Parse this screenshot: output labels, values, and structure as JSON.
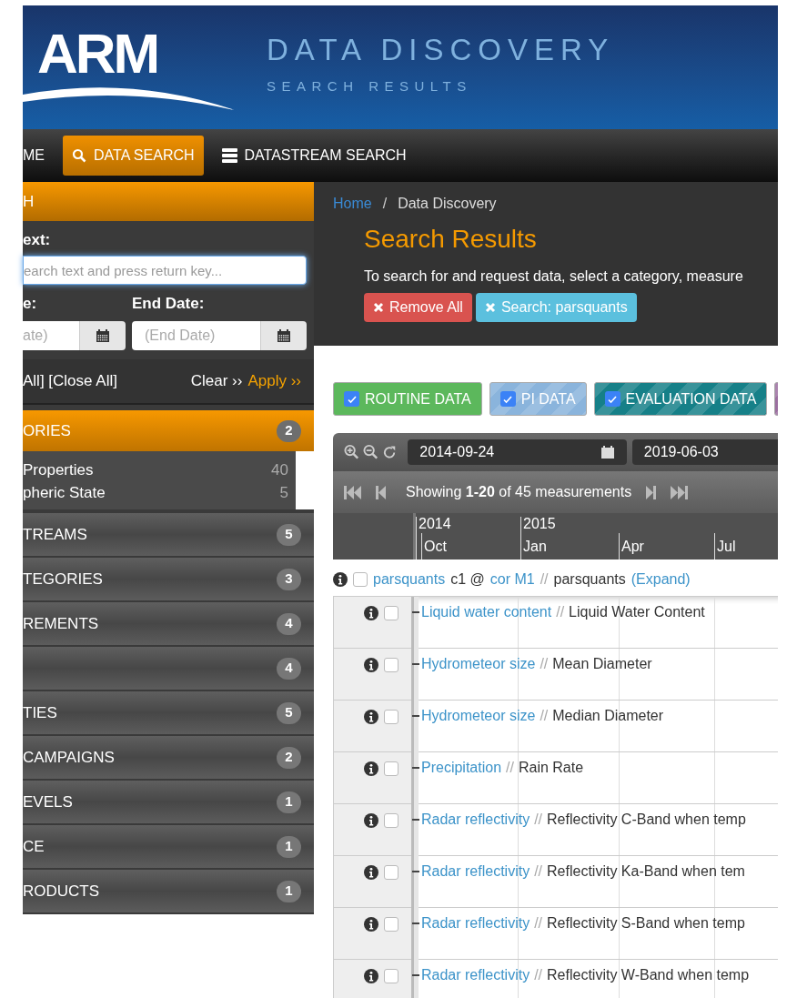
{
  "header": {
    "logo": "ARM",
    "title": "DATA DISCOVERY",
    "subtitle": "SEARCH RESULTS"
  },
  "nav": [
    {
      "label": "ME",
      "selected": false,
      "kind": "plain"
    },
    {
      "label": "DATA SEARCH",
      "selected": true,
      "kind": "search"
    },
    {
      "label": "DATASTREAM SEARCH",
      "selected": false,
      "kind": "server"
    }
  ],
  "sidebar": {
    "heading": "H",
    "text_label": "ext:",
    "search_placeholder": "earch text and press return key...",
    "start_label": "e:",
    "end_label": "End Date:",
    "start_placeholder": "ate)",
    "end_placeholder": "(End Date)",
    "toggle_links": "All] [Close All]",
    "clear": "Clear ››",
    "apply": "Apply ››",
    "facets": [
      {
        "label": "ORIES",
        "count": "2",
        "expanded": true,
        "children": [
          {
            "label": "Properties",
            "count": "40"
          },
          {
            "label": "pheric State",
            "count": "5"
          }
        ]
      },
      {
        "label": "TREAMS",
        "count": "5",
        "expanded": false
      },
      {
        "label": "TEGORIES",
        "count": "3",
        "expanded": false
      },
      {
        "label": "REMENTS",
        "count": "4",
        "expanded": false
      },
      {
        "count": "4",
        "expanded": false
      },
      {
        "label": "TIES",
        "count": "5",
        "expanded": false
      },
      {
        "label": "CAMPAIGNS",
        "count": "2",
        "expanded": false
      },
      {
        "label": "EVELS",
        "count": "1",
        "expanded": false
      },
      {
        "label": "CE",
        "count": "1",
        "expanded": false
      },
      {
        "label": "RODUCTS",
        "count": "1",
        "expanded": false
      }
    ]
  },
  "main": {
    "breadcrumb": [
      {
        "label": "Home",
        "kind": "link"
      },
      {
        "label": "/",
        "kind": "separator"
      },
      {
        "label": "Data Discovery",
        "kind": "current"
      }
    ],
    "title": "Search Results",
    "description": "To search for and request data, select a category, measure",
    "filters": [
      {
        "label": "Remove All",
        "kind": "remove"
      },
      {
        "label": "Search: parsquants",
        "kind": "search"
      }
    ],
    "data_types": [
      {
        "label": "ROUTINE DATA",
        "checked": true,
        "kind": "routine"
      },
      {
        "label": "PI DATA",
        "checked": true,
        "kind": "pi"
      },
      {
        "label": "EVALUATION DATA",
        "checked": true,
        "kind": "evaluation"
      },
      {
        "kind": "other"
      }
    ],
    "timeline": {
      "start": "2014-09-24",
      "end": "2019-06-03",
      "pager": "Showing **1-20** of 45 measurements",
      "years": [
        "2014",
        "2015"
      ],
      "months": [
        "Oct",
        "Jan",
        "Apr",
        "Jul"
      ]
    },
    "datastream": {
      "checked": false,
      "parts": [
        {
          "text": "parsquants",
          "kind": "link"
        },
        {
          "text": "c1 @",
          "kind": "plain"
        },
        {
          "text": "cor M1",
          "kind": "link"
        },
        {
          "text": "//",
          "kind": "sep"
        },
        {
          "text": "parsquants",
          "kind": "plain"
        },
        {
          "text": "(Expand)",
          "kind": "link"
        }
      ]
    },
    "measurements": [
      {
        "name": "Liquid water content",
        "separator": "//",
        "description": "Liquid Water Content",
        "checked": false
      },
      {
        "name": "Hydrometeor size",
        "separator": "//",
        "description": "Mean Diameter",
        "checked": false
      },
      {
        "name": "Hydrometeor size",
        "separator": "//",
        "description": "Median Diameter",
        "checked": false
      },
      {
        "name": "Precipitation",
        "separator": "//",
        "description": "Rain Rate",
        "checked": false
      },
      {
        "name": "Radar reflectivity",
        "separator": "//",
        "description": "Reflectivity C-Band when temp",
        "checked": false
      },
      {
        "name": "Radar reflectivity",
        "separator": "//",
        "description": "Reflectivity Ka-Band when tem",
        "checked": false
      },
      {
        "name": "Radar reflectivity",
        "separator": "//",
        "description": "Reflectivity S-Band when temp",
        "checked": false
      },
      {
        "name": "Radar reflectivity",
        "separator": "//",
        "description": "Reflectivity W-Band when temp",
        "checked": false
      }
    ]
  }
}
